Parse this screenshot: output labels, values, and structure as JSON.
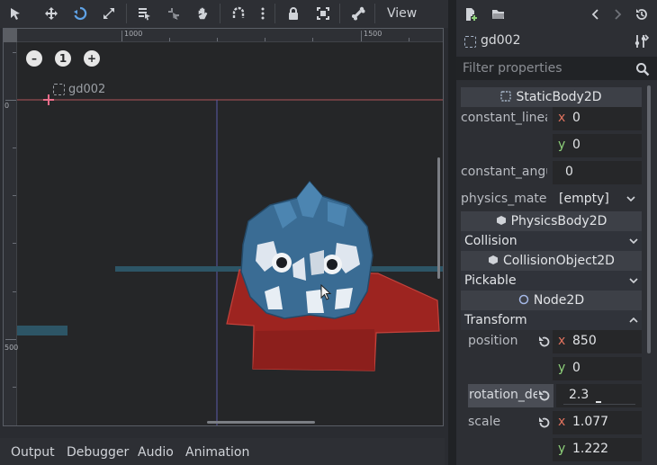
{
  "toolbar": {
    "view_label": "View",
    "icons": [
      "select-icon",
      "move-icon",
      "rotate-icon",
      "scale-icon",
      "list-select-icon",
      "pivot-icon",
      "pan-icon",
      "snap-icon",
      "more-icon",
      "lock-icon",
      "group-icon",
      "bone-icon"
    ]
  },
  "viewport": {
    "ruler_labels": {
      "x1000": "1000",
      "x1500": "1500",
      "y0": "0",
      "y500": "500"
    },
    "zoom_reset_label": "1",
    "node_label": "gd002"
  },
  "bottom_tabs": [
    "Output",
    "Debugger",
    "Audio",
    "Animation"
  ],
  "inspector": {
    "object_name": "gd002",
    "filter_placeholder": "Filter properties",
    "static_body_header": "StaticBody2D",
    "constant_linear_label": "constant_linea",
    "constant_linear_x": "0",
    "constant_linear_y": "0",
    "constant_angular_label": "constant_angu",
    "constant_angular_value": "0",
    "physics_material_label": "physics_materi",
    "physics_material_value": "[empty]",
    "physics_body_header": "PhysicsBody2D",
    "collision_section": "Collision",
    "collision_object_header": "CollisionObject2D",
    "pickable_section": "Pickable",
    "node2d_header": "Node2D",
    "transform_section": "Transform",
    "position_label": "position",
    "position_x": "850",
    "position_y": "0",
    "rotation_label": "rotation_de",
    "rotation_value": "2.3",
    "scale_label": "scale",
    "scale_x": "1.077",
    "scale_y": "1.222",
    "axis_x": "x",
    "axis_y": "y"
  },
  "colors": {
    "accent": "#5fa2e6",
    "collision_shape": "#c8302a",
    "axis_x": "#e0725e",
    "axis_y": "#8ed17a"
  }
}
